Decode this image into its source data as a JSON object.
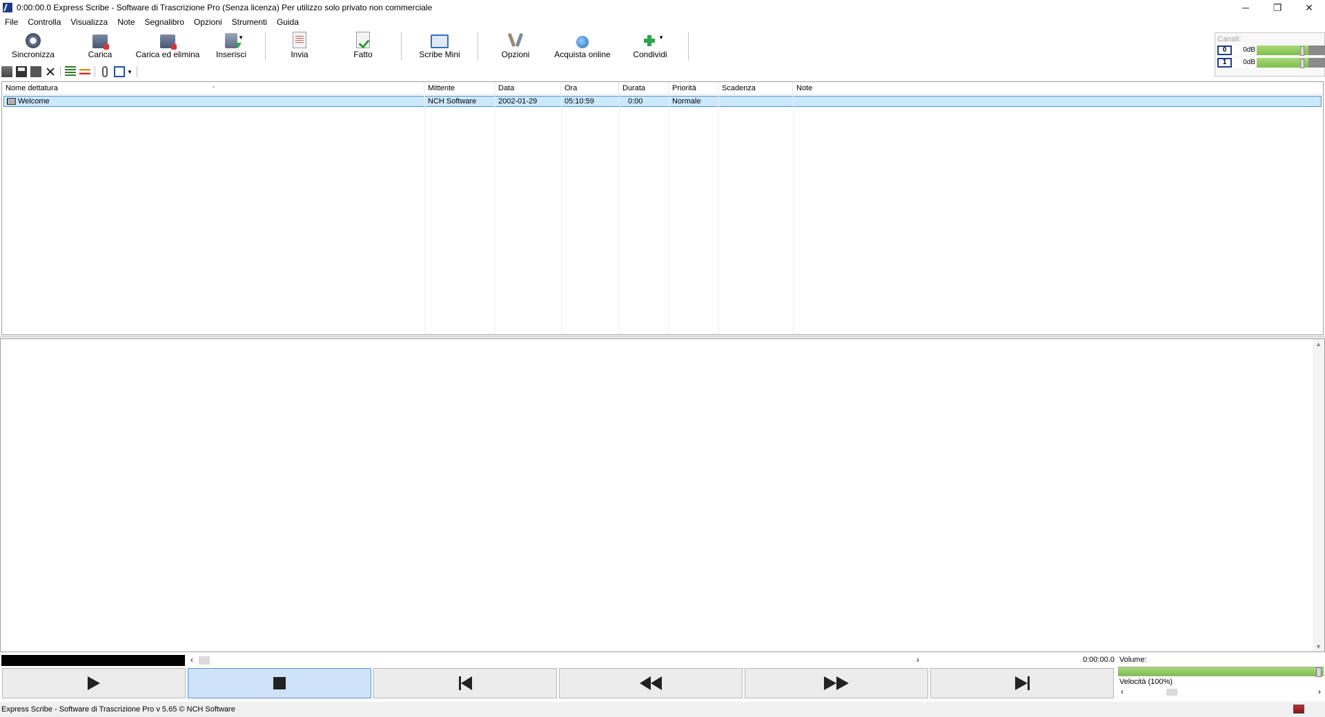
{
  "window": {
    "title": "0:00:00.0 Express Scribe - Software di Trascrizione Pro (Senza licenza) Per utilizzo solo privato non commerciale",
    "minimize": "─",
    "restore": "❐",
    "close": "✕"
  },
  "menu": [
    "File",
    "Controlla",
    "Visualizza",
    "Note",
    "Segnalibro",
    "Opzioni",
    "Strumenti",
    "Guida"
  ],
  "toolbar": {
    "sync": "Sincronizza",
    "load": "Carica",
    "load_delete": "Carica ed elimina",
    "insert": "Inserisci",
    "send": "Invia",
    "done": "Fatto",
    "scribe_mini": "Scribe Mini",
    "options": "Opzioni",
    "buy_online": "Acquista online",
    "share": "Condividi"
  },
  "channels": {
    "title": "Canali:",
    "rows": [
      {
        "num": "0",
        "level": "0dB"
      },
      {
        "num": "1",
        "level": "0dB"
      }
    ]
  },
  "list": {
    "headers": [
      "Nome dettatura",
      "Mittente",
      "Data",
      "Ora",
      "Durata",
      "Priorità",
      "Scadenza",
      "Note"
    ],
    "rows": [
      {
        "name": "Welcome",
        "sender": "NCH Software",
        "date": "2002-01-29",
        "time": "05:10:59",
        "duration": "0:00",
        "priority": "Normale",
        "due": "",
        "notes": ""
      }
    ]
  },
  "player": {
    "time": "0:00:00.0",
    "volume_label": "Volume:",
    "volume_level": 1.0,
    "speed_label": "Velocità (100%)",
    "speed_percent": 100
  },
  "status": {
    "text": "Express Scribe - Software di Trascrizione Pro v 5.65 © NCH Software"
  }
}
